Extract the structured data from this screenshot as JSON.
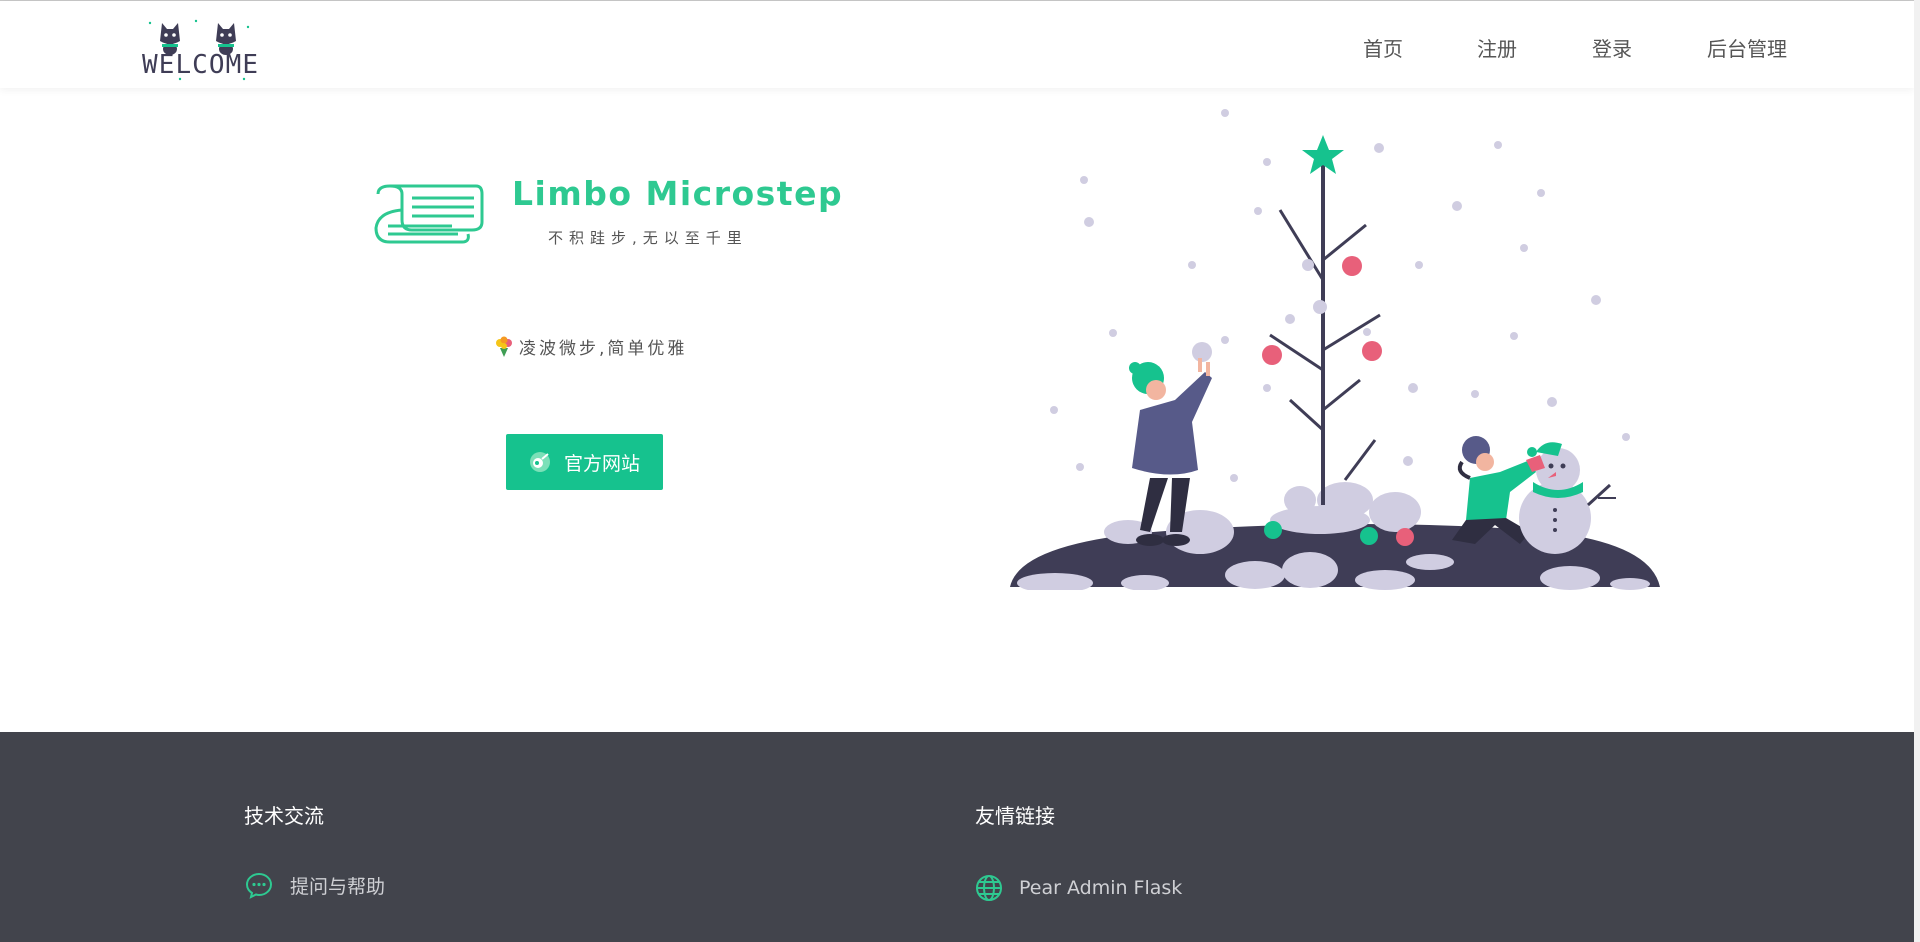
{
  "header": {
    "logo_text": "WELCOME",
    "nav": [
      "首页",
      "注册",
      "登录",
      "后台管理"
    ]
  },
  "hero": {
    "brand_title": "Limbo Microstep",
    "brand_subtitle": "不积跬步,无以至千里",
    "slogan": "凌波微步,简单优雅",
    "site_button": "官方网站"
  },
  "footer": {
    "col1_title": "技术交流",
    "col1_link": "提问与帮助",
    "col2_title": "友情链接",
    "col2_link": "Pear Admin Flask"
  },
  "icons": {
    "logo": "welcome-cats-logo",
    "book": "book-logo-icon",
    "slogan": "flower-bouquet-icon",
    "button": "comet-icon",
    "help": "chat-bubble-icon",
    "links": "globe-icon"
  },
  "colors": {
    "accent": "#16c28e",
    "brand": "#2ec991",
    "footer_bg": "#42444c",
    "illustration_dark": "#3f3d56",
    "ornament_red": "#e8607a",
    "snow": "#d0cde1"
  }
}
